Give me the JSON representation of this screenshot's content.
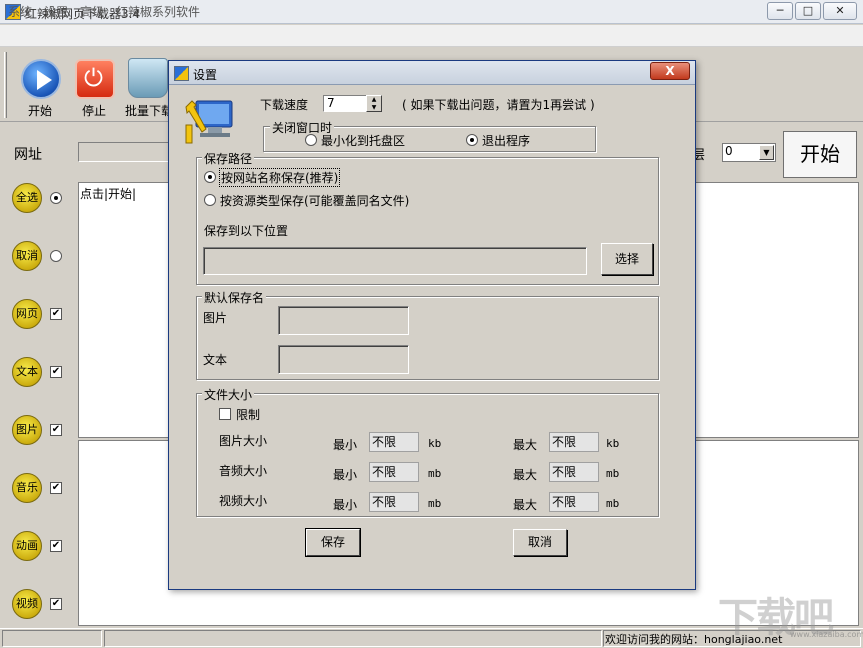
{
  "window": {
    "title": "红辣椒网页下载器3.4",
    "controls": {
      "minimize": "─",
      "maximize": "□",
      "close": "✕"
    }
  },
  "menu": [
    "系统",
    "设置",
    "高级",
    "红辣椒系列软件"
  ],
  "toolbar": {
    "start": "开始",
    "stop": "停止",
    "batch": "批量下载"
  },
  "main": {
    "url_label": "网址",
    "depth_label": "层",
    "depth_value": "0",
    "start_button": "开始",
    "list_hint": "点击|开始|",
    "side_buttons": [
      {
        "label": "全选",
        "control": "radio",
        "checked": true
      },
      {
        "label": "取消",
        "control": "radio",
        "checked": false
      },
      {
        "label": "网页",
        "control": "check",
        "checked": true
      },
      {
        "label": "文本",
        "control": "check",
        "checked": true
      },
      {
        "label": "图片",
        "control": "check",
        "checked": true
      },
      {
        "label": "音乐",
        "control": "check",
        "checked": true
      },
      {
        "label": "动画",
        "control": "check",
        "checked": true
      },
      {
        "label": "视频",
        "control": "check",
        "checked": true
      }
    ]
  },
  "status": {
    "text": "欢迎访问我的网站：honglajiao.net"
  },
  "dialog": {
    "title": "设置",
    "close": "X",
    "speed_label": "下载速度",
    "speed_value": "7",
    "speed_hint": "( 如果下载出问题，请置为1再尝试 )",
    "close_group": {
      "title": "关闭窗口时",
      "option_tray": "最小化到托盘区",
      "option_exit": "退出程序",
      "selected": "exit"
    },
    "save_path": {
      "title": "保存路径",
      "option_site": "按网站名称保存(推荐)",
      "option_type": "按资源类型保存(可能覆盖同名文件)",
      "selected": "site",
      "location_label": "保存到以下位置",
      "location_value": "",
      "choose_button": "选择"
    },
    "default_name": {
      "title": "默认保存名",
      "image_label": "图片",
      "image_value": "",
      "text_label": "文本",
      "text_value": ""
    },
    "file_size": {
      "title": "文件大小",
      "limit_label": "限制",
      "limit_checked": false,
      "min_label": "最小",
      "max_label": "最大",
      "rows": [
        {
          "label": "图片大小",
          "min": "不限",
          "max": "不限",
          "unit": "kb"
        },
        {
          "label": "音频大小",
          "min": "不限",
          "max": "不限",
          "unit": "mb"
        },
        {
          "label": "视频大小",
          "min": "不限",
          "max": "不限",
          "unit": "mb"
        }
      ]
    },
    "save_button": "保存",
    "cancel_button": "取消"
  },
  "watermark": {
    "text": "下载吧",
    "url": "www.xiazaiba.com"
  },
  "colors": {
    "dialog_bg": "#d4d0c8",
    "title_close": "#c23a1e",
    "side_button": "#e8d21a"
  }
}
